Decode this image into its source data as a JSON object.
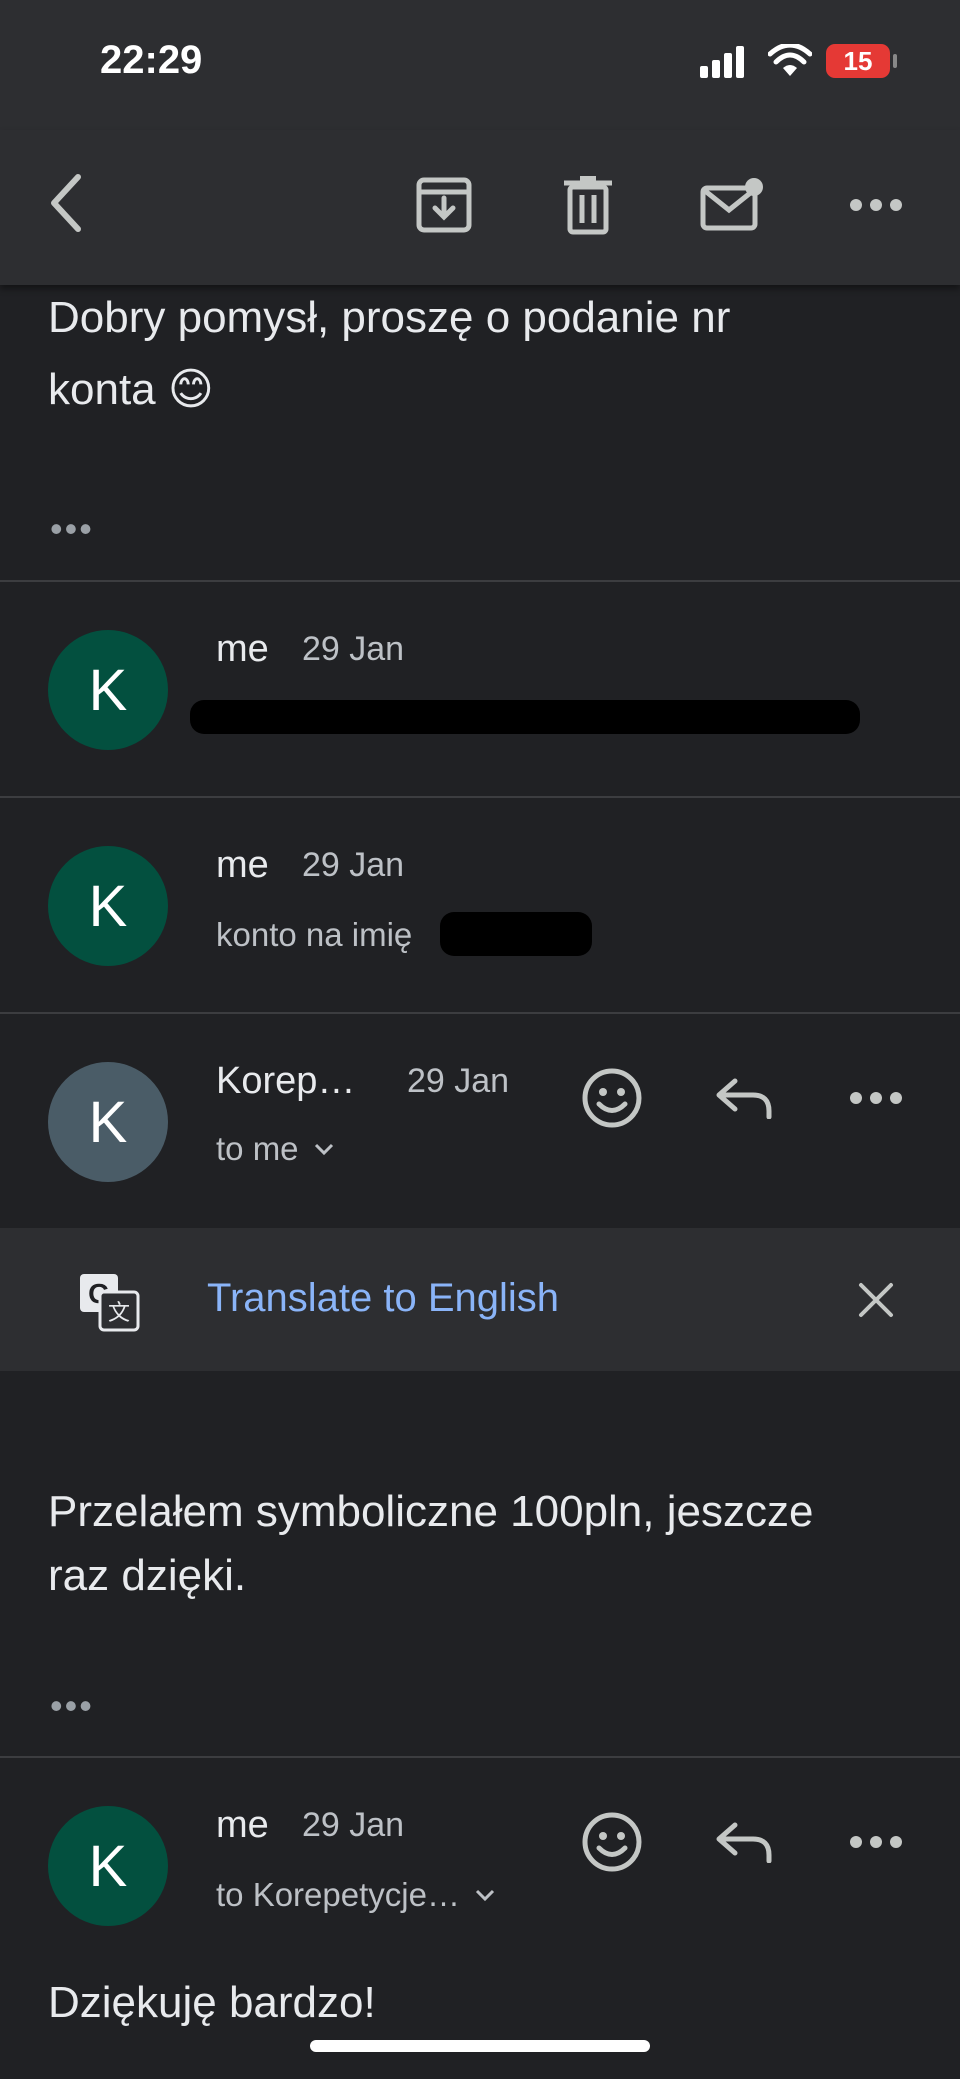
{
  "status_bar": {
    "time": "22:29",
    "battery": "15"
  },
  "toolbar": {
    "back_icon": "chevron-left-icon",
    "archive_icon": "archive-icon",
    "delete_icon": "trash-icon",
    "mark_unread_icon": "mail-unread-icon",
    "more_icon": "more-horizontal-icon"
  },
  "thread": {
    "top_message": {
      "line1": "Dobry pomysł, proszę o podanie nr",
      "line2": "konta 😊",
      "expand": "•••"
    },
    "messages": [
      {
        "initial": "K",
        "sender": "me",
        "date": "29 Jan",
        "snippet": ""
      },
      {
        "initial": "K",
        "sender": "me",
        "date": "29 Jan",
        "snippet": "konto na imię"
      },
      {
        "initial": "K",
        "sender": "Korep…",
        "date": "29 Jan",
        "recipient": "to me"
      },
      {
        "initial": "K",
        "sender": "me",
        "date": "29 Jan",
        "recipient": "to Korepetycje…"
      }
    ],
    "translate": {
      "label": "Translate to English"
    },
    "expanded_body": {
      "line1": "Przelałem symboliczne 100pln, jeszcze",
      "line2": "raz dzięki.",
      "expand": "•••"
    },
    "last_body": "Dziękuję bardzo!"
  },
  "colors": {
    "background": "#202124",
    "avatar_me": "#03503f",
    "avatar_other": "#4a5c67",
    "link": "#8ab4f8"
  }
}
